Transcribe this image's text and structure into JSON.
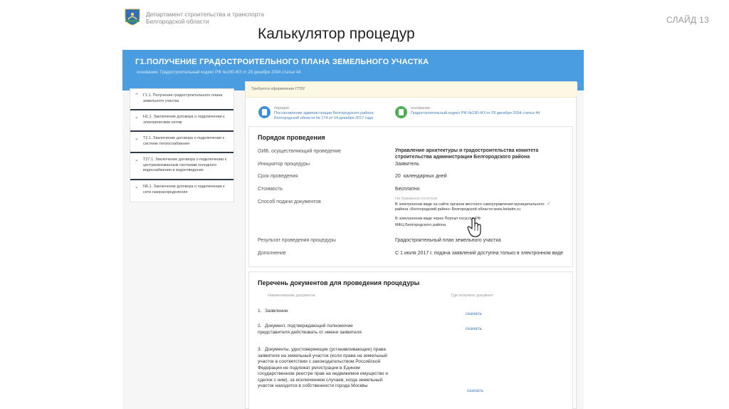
{
  "slide": {
    "org_line1": "Департамент строительства и транспорта",
    "org_line2": "Белгородской области",
    "slide_number": "СЛАЙД 13",
    "title": "Калькулятор процедур"
  },
  "banner": {
    "title": "Г1.ПОЛУЧЕНИЕ ГРАДОСТРОИТЕЛЬНОГО ПЛАНА ЗЕМЕЛЬНОГО УЧАСТКА",
    "subtitle": "основание: Градостроительный кодекс РФ №190-ФЗ от 29 декабря 2004 статья 44",
    "color": "#4a9de0"
  },
  "menu": {
    "items": [
      {
        "label": "Г1.1. Получение градостроительного плана земельного участка"
      },
      {
        "label": "Н1.1. Заключение договора о подключении к электрическим сетям"
      },
      {
        "label": "Т2.1. Заключение договора о подключении к системе теплоснабжения"
      },
      {
        "label": "Т27.1. Заключение договора о подключении к централизованным системам холодного водоснабжения и водоотведения"
      },
      {
        "label": "N6.1. Заключение договора о подключении к сети газораспределения"
      }
    ]
  },
  "notice": {
    "text": "Требуется оформление ГПЗУ"
  },
  "basis": {
    "left_label": "порядок:",
    "left_link": "Постановление администрации Белгородского района Белгородской области № 174 от 14 декабря 2017 года",
    "right_label": "основание:",
    "right_link": "Градостроительный кодекс РФ №190-ФЗ от 29 декабря 2004 статья 44",
    "left_color": "#3f8fd8",
    "right_color": "#4caf50"
  },
  "procedure": {
    "title": "Порядок проведения",
    "rows": {
      "oiv_label": "ОИВ, осуществляющий проведение",
      "oiv_value": "Управление архитектуры и градостроительства комитета строительства администрации Белгородского района",
      "initiator_label": "Инициатор процедуры",
      "initiator_value": "Заявитель",
      "term_label": "Срок проведения",
      "term_days": "20",
      "term_unit": "календарных дней",
      "cost_label": "Стоимость",
      "cost_value": "Бесплатно",
      "method_label": "Способ подачи документов",
      "method_paper": "На бумажном носителе",
      "method_electronic_site": "В электронном виде на сайте органов местного самоуправления муниципального района «Белгородский район» Белгородской области www.beladm.ru",
      "method_portal": "В электронном виде через Портал госуслуг РФ",
      "method_mfc": "МФЦ Белгородского района",
      "result_label": "Результат проведения процедуры",
      "result_value": "Градостроительный план земельного участка",
      "extra_label": "Дополнение",
      "extra_value": "С 1 июля 2017 г. подача заявлений доступна только в электронном виде"
    }
  },
  "documents": {
    "title": "Перечень документов для проведения процедуры",
    "col_name": "Наименование документа",
    "col_where": "Где получить документ",
    "items": [
      {
        "num": "1.",
        "name": "Заявление",
        "link": "скачать"
      },
      {
        "num": "2.",
        "name": "Документ, подтверждающий полномочие представителя действовать от имени заявителя",
        "link": "скачать"
      },
      {
        "num": "3.",
        "name": "Документы, удостоверяющие (устанавливающие) права заявителя на земельный участок (если права на земельный участок в соответствии с законодательством Российской Федерации не подлежат регистрации в Едином государственном реестре прав на недвижимое имущество и сделок с ним), за исключением случаев, когда земельный участок находится в собственности города Москвы",
        "link": "скачать"
      }
    ]
  }
}
